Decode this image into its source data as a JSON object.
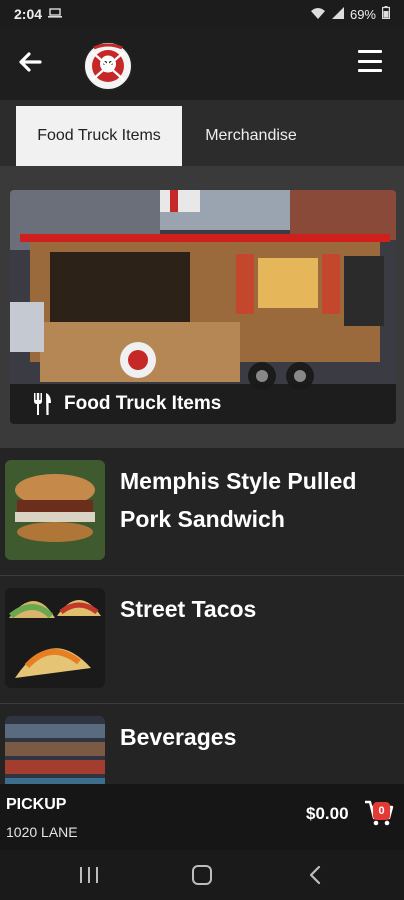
{
  "status": {
    "time": "2:04",
    "battery": "69%"
  },
  "tabs": [
    {
      "label": "Food Truck Items",
      "active": true
    },
    {
      "label": "Merchandise",
      "active": false
    }
  ],
  "hero": {
    "label": "Food Truck Items",
    "icon": "utensils-icon"
  },
  "items": [
    {
      "title": "Memphis Style Pulled Pork Sandwich",
      "thumb": "sandwich-photo"
    },
    {
      "title": "Street Tacos",
      "thumb": "tacos-photo"
    },
    {
      "title": "Beverages",
      "thumb": "beverages-photo"
    }
  ],
  "bottom": {
    "order_type": "PICKUP",
    "location": "1020 LANE",
    "total": "$0.00",
    "cart_count": "0"
  },
  "icons": {
    "back": "back-arrow-icon",
    "menu": "hamburger-menu-icon",
    "cart": "cart-icon",
    "wifi": "wifi-icon",
    "signal": "signal-icon",
    "battery": "battery-icon"
  },
  "colors": {
    "tab_active_bg": "#f1f1f1",
    "badge": "#e53935",
    "background": "#2a2a2a"
  }
}
